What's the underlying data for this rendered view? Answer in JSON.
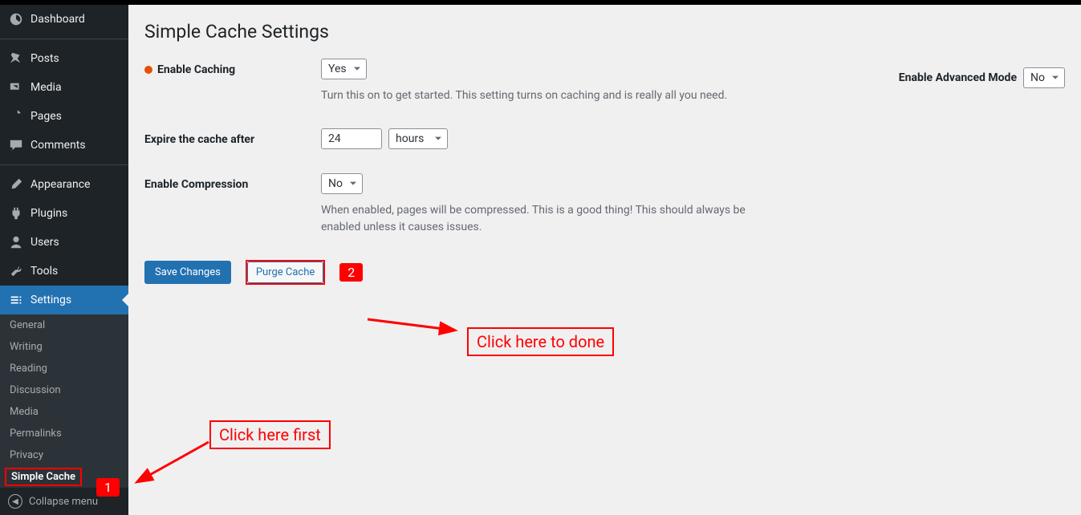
{
  "sidebar": {
    "items": [
      {
        "label": "Dashboard"
      },
      {
        "label": "Posts"
      },
      {
        "label": "Media"
      },
      {
        "label": "Pages"
      },
      {
        "label": "Comments"
      },
      {
        "label": "Appearance"
      },
      {
        "label": "Plugins"
      },
      {
        "label": "Users"
      },
      {
        "label": "Tools"
      },
      {
        "label": "Settings"
      }
    ],
    "submenu": [
      {
        "label": "General"
      },
      {
        "label": "Writing"
      },
      {
        "label": "Reading"
      },
      {
        "label": "Discussion"
      },
      {
        "label": "Media"
      },
      {
        "label": "Permalinks"
      },
      {
        "label": "Privacy"
      },
      {
        "label": "Simple Cache"
      }
    ],
    "collapse": "Collapse menu"
  },
  "page": {
    "title": "Simple Cache Settings",
    "advanced_label": "Enable Advanced Mode",
    "advanced_value": "No"
  },
  "form": {
    "enable_caching": {
      "label": "Enable Caching",
      "value": "Yes",
      "desc": "Turn this on to get started. This setting turns on caching and is really all you need."
    },
    "expire": {
      "label": "Expire the cache after",
      "value": "24",
      "unit": "hours"
    },
    "compression": {
      "label": "Enable Compression",
      "value": "No",
      "desc": "When enabled, pages will be compressed. This is a good thing! This should always be enabled unless it causes issues."
    },
    "buttons": {
      "save": "Save Changes",
      "purge": "Purge Cache"
    }
  },
  "annotations": {
    "badge1": "1",
    "badge2": "2",
    "callout1": "Click here first",
    "callout2": "Click here to done"
  }
}
